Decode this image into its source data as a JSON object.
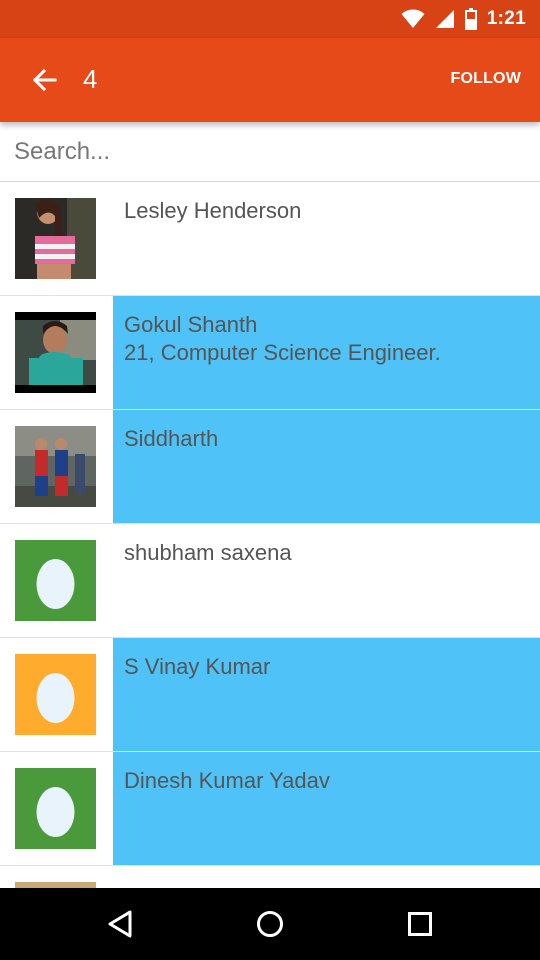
{
  "status_bar": {
    "time": "1:21"
  },
  "app_bar": {
    "title": "4",
    "follow_label": "FOLLOW"
  },
  "search": {
    "placeholder": "Search...",
    "value": ""
  },
  "users": [
    {
      "name": "Lesley Henderson",
      "bio": "",
      "selected": false,
      "avatar": "photo"
    },
    {
      "name": "Gokul Shanth",
      "bio": "21, Computer Science Engineer.",
      "selected": true,
      "avatar": "photo"
    },
    {
      "name": "Siddharth",
      "bio": "",
      "selected": true,
      "avatar": "photo"
    },
    {
      "name": "shubham saxena",
      "bio": "",
      "selected": false,
      "avatar": "egg",
      "avatar_color": "#4a9a3c"
    },
    {
      "name": "S Vinay Kumar",
      "bio": "",
      "selected": true,
      "avatar": "egg",
      "avatar_color": "#ffab2e"
    },
    {
      "name": "Dinesh Kumar Yadav",
      "bio": "",
      "selected": true,
      "avatar": "egg",
      "avatar_color": "#4a9a3c"
    }
  ],
  "colors": {
    "status_bar": "#d84315",
    "app_bar": "#e64a19",
    "selected_row": "#4fc3f7"
  },
  "nav_bar": {
    "icons": [
      "back-triangle-icon",
      "home-circle-icon",
      "recents-square-icon"
    ]
  }
}
